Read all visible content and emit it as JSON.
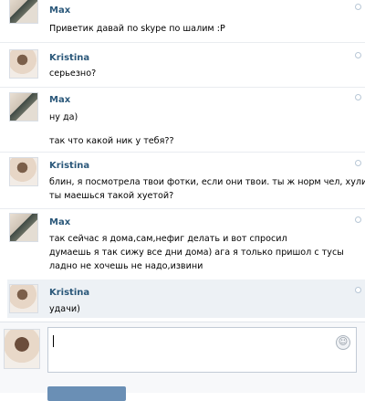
{
  "messages": [
    {
      "author": "Max",
      "lines": [
        "Приветик давай по skype по шалим :P"
      ]
    },
    {
      "author": "Kristina",
      "lines": [
        "серьезно?"
      ]
    },
    {
      "author": "Max",
      "lines": [
        "ну да)",
        "так что какой ник у тебя??"
      ]
    },
    {
      "author": "Kristina",
      "lines": [
        "блин, я посмотрела твои фотки, если они твои. ты ж норм чел, хули",
        "ты маешься такой хуетой?"
      ]
    },
    {
      "author": "Max",
      "lines": [
        "так сейчас я дома,сам,нефиг делать и вот спросил",
        "думаешь я так сижу все дни дома) ага я только пришол с тусы",
        "ладно не хочешь не надо,извини"
      ]
    },
    {
      "author": "Kristina",
      "lines": [
        "удачи)"
      ]
    }
  ],
  "composer": {
    "value": "",
    "emoji_icon": "smiley-icon"
  }
}
